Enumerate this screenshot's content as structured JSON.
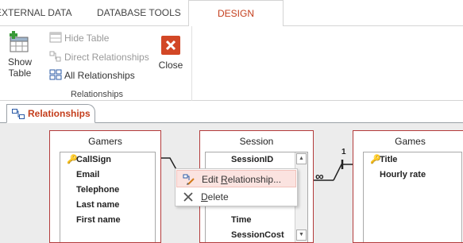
{
  "tabs": [
    {
      "label": "EXTERNAL DATA"
    },
    {
      "label": "DATABASE TOOLS"
    },
    {
      "label": "DESIGN"
    }
  ],
  "ribbon": {
    "show_table_line1": "Show",
    "show_table_line2": "Table",
    "hide_table": "Hide Table",
    "direct_relationships": "Direct Relationships",
    "all_relationships": "All Relationships",
    "close": "Close",
    "group_label": "Relationships"
  },
  "document_tab": {
    "label": "Relationships"
  },
  "tables": {
    "gamers": {
      "title": "Gamers",
      "fields": [
        "CallSign",
        "Email",
        "Telephone",
        "Last name",
        "First name"
      ]
    },
    "session": {
      "title": "Session",
      "fields": [
        "SessionID",
        "",
        "",
        "",
        "Time",
        "SessionCost"
      ]
    },
    "games": {
      "title": "Games",
      "fields": [
        "Title",
        "Hourly rate"
      ]
    }
  },
  "relationship": {
    "one_label": "1",
    "many_label": "∞"
  },
  "context_menu": {
    "edit_prefix": "Edit ",
    "edit_underlined": "R",
    "edit_suffix": "elationship...",
    "delete_underlined": "D",
    "delete_suffix": "elete"
  },
  "colors": {
    "accent": "#c43e1c",
    "table_border": "#b33b3b",
    "highlight": "#fbe3e0"
  }
}
